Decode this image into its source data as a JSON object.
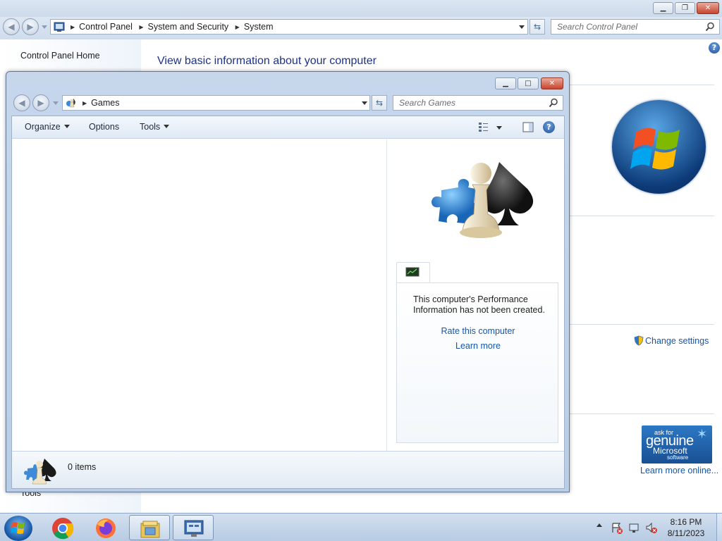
{
  "control_panel": {
    "breadcrumb": [
      "Control Panel",
      "System and Security",
      "System"
    ],
    "search_placeholder": "Search Control Panel",
    "sidebar_home": "Control Panel Home",
    "sidebar_tools": "Tools",
    "heading": "View basic information about your computer",
    "change_settings": "Change settings",
    "genuine_badge": {
      "line1": "ask for",
      "line2": "genuine",
      "line3": "Microsoft",
      "line4": "software"
    },
    "learn_more_online": "Learn more online..."
  },
  "games_window": {
    "breadcrumb": [
      "Games"
    ],
    "search_placeholder": "Search Games",
    "toolbar": {
      "organize": "Organize",
      "options": "Options",
      "tools": "Tools"
    },
    "performance_text": "This computer's Performance Information has not been created.",
    "rate_link": "Rate this computer",
    "learn_more_link": "Learn more",
    "items_count": "0 items"
  },
  "taskbar": {
    "apps": [
      "chrome-icon",
      "firefox-icon",
      "file-explorer-icon",
      "control-panel-icon"
    ],
    "clock_time": "8:16 PM",
    "clock_date": "8/11/2023"
  },
  "colors": {
    "link": "#1556a8",
    "heading": "#1e3287",
    "window_frame": "#b9cde6"
  }
}
